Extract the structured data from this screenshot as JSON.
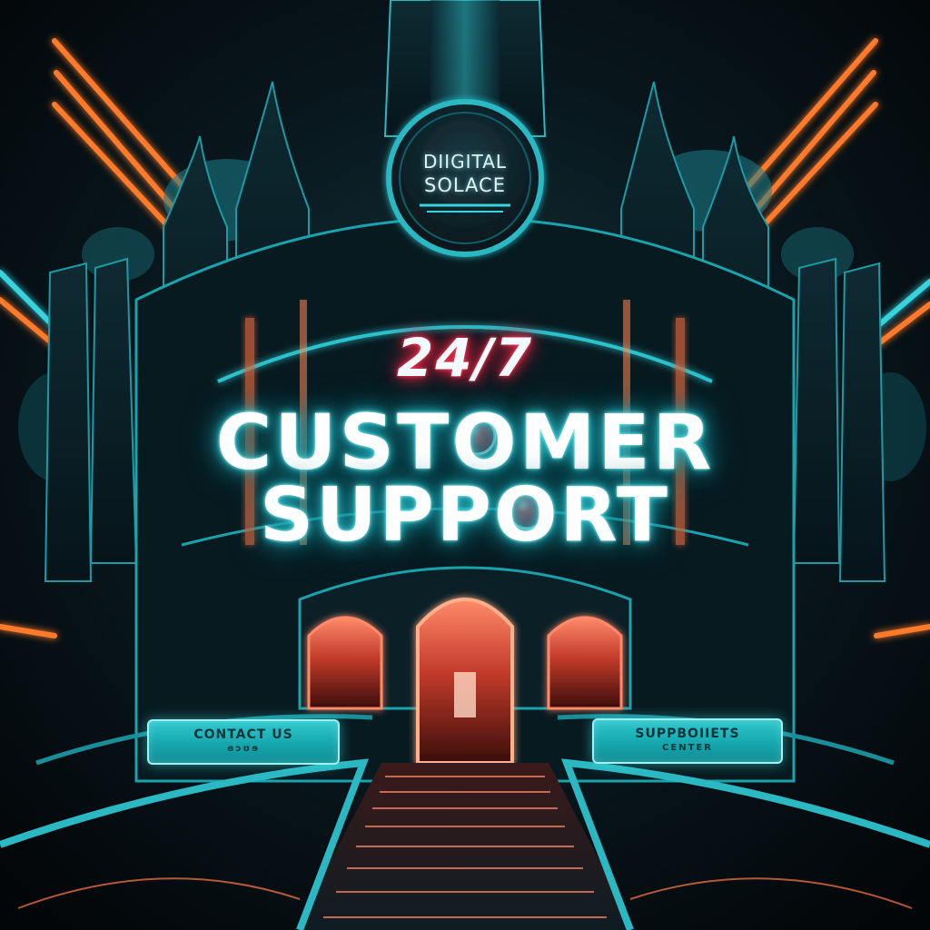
{
  "sign": {
    "line1": "DIIGITAL",
    "line2": "SOLACE"
  },
  "headline": {
    "pre": "24/7",
    "line1": "CUSTOMER",
    "line2": "SUPPORT"
  },
  "buttons": {
    "contact": {
      "line1": "CONTACT US",
      "line2": "ɞɔʊɘ"
    },
    "support_center": {
      "line1": "SUPPBOIIETS",
      "line2": "CENTER"
    }
  },
  "colors": {
    "neon_cyan": "#39d3dc",
    "neon_orange": "#ff7a2a",
    "neon_red": "#ff2a4a",
    "button_teal": "#1fb3ba",
    "background": "#050a0e"
  },
  "icons": {
    "orb": "red-orb-icon"
  }
}
